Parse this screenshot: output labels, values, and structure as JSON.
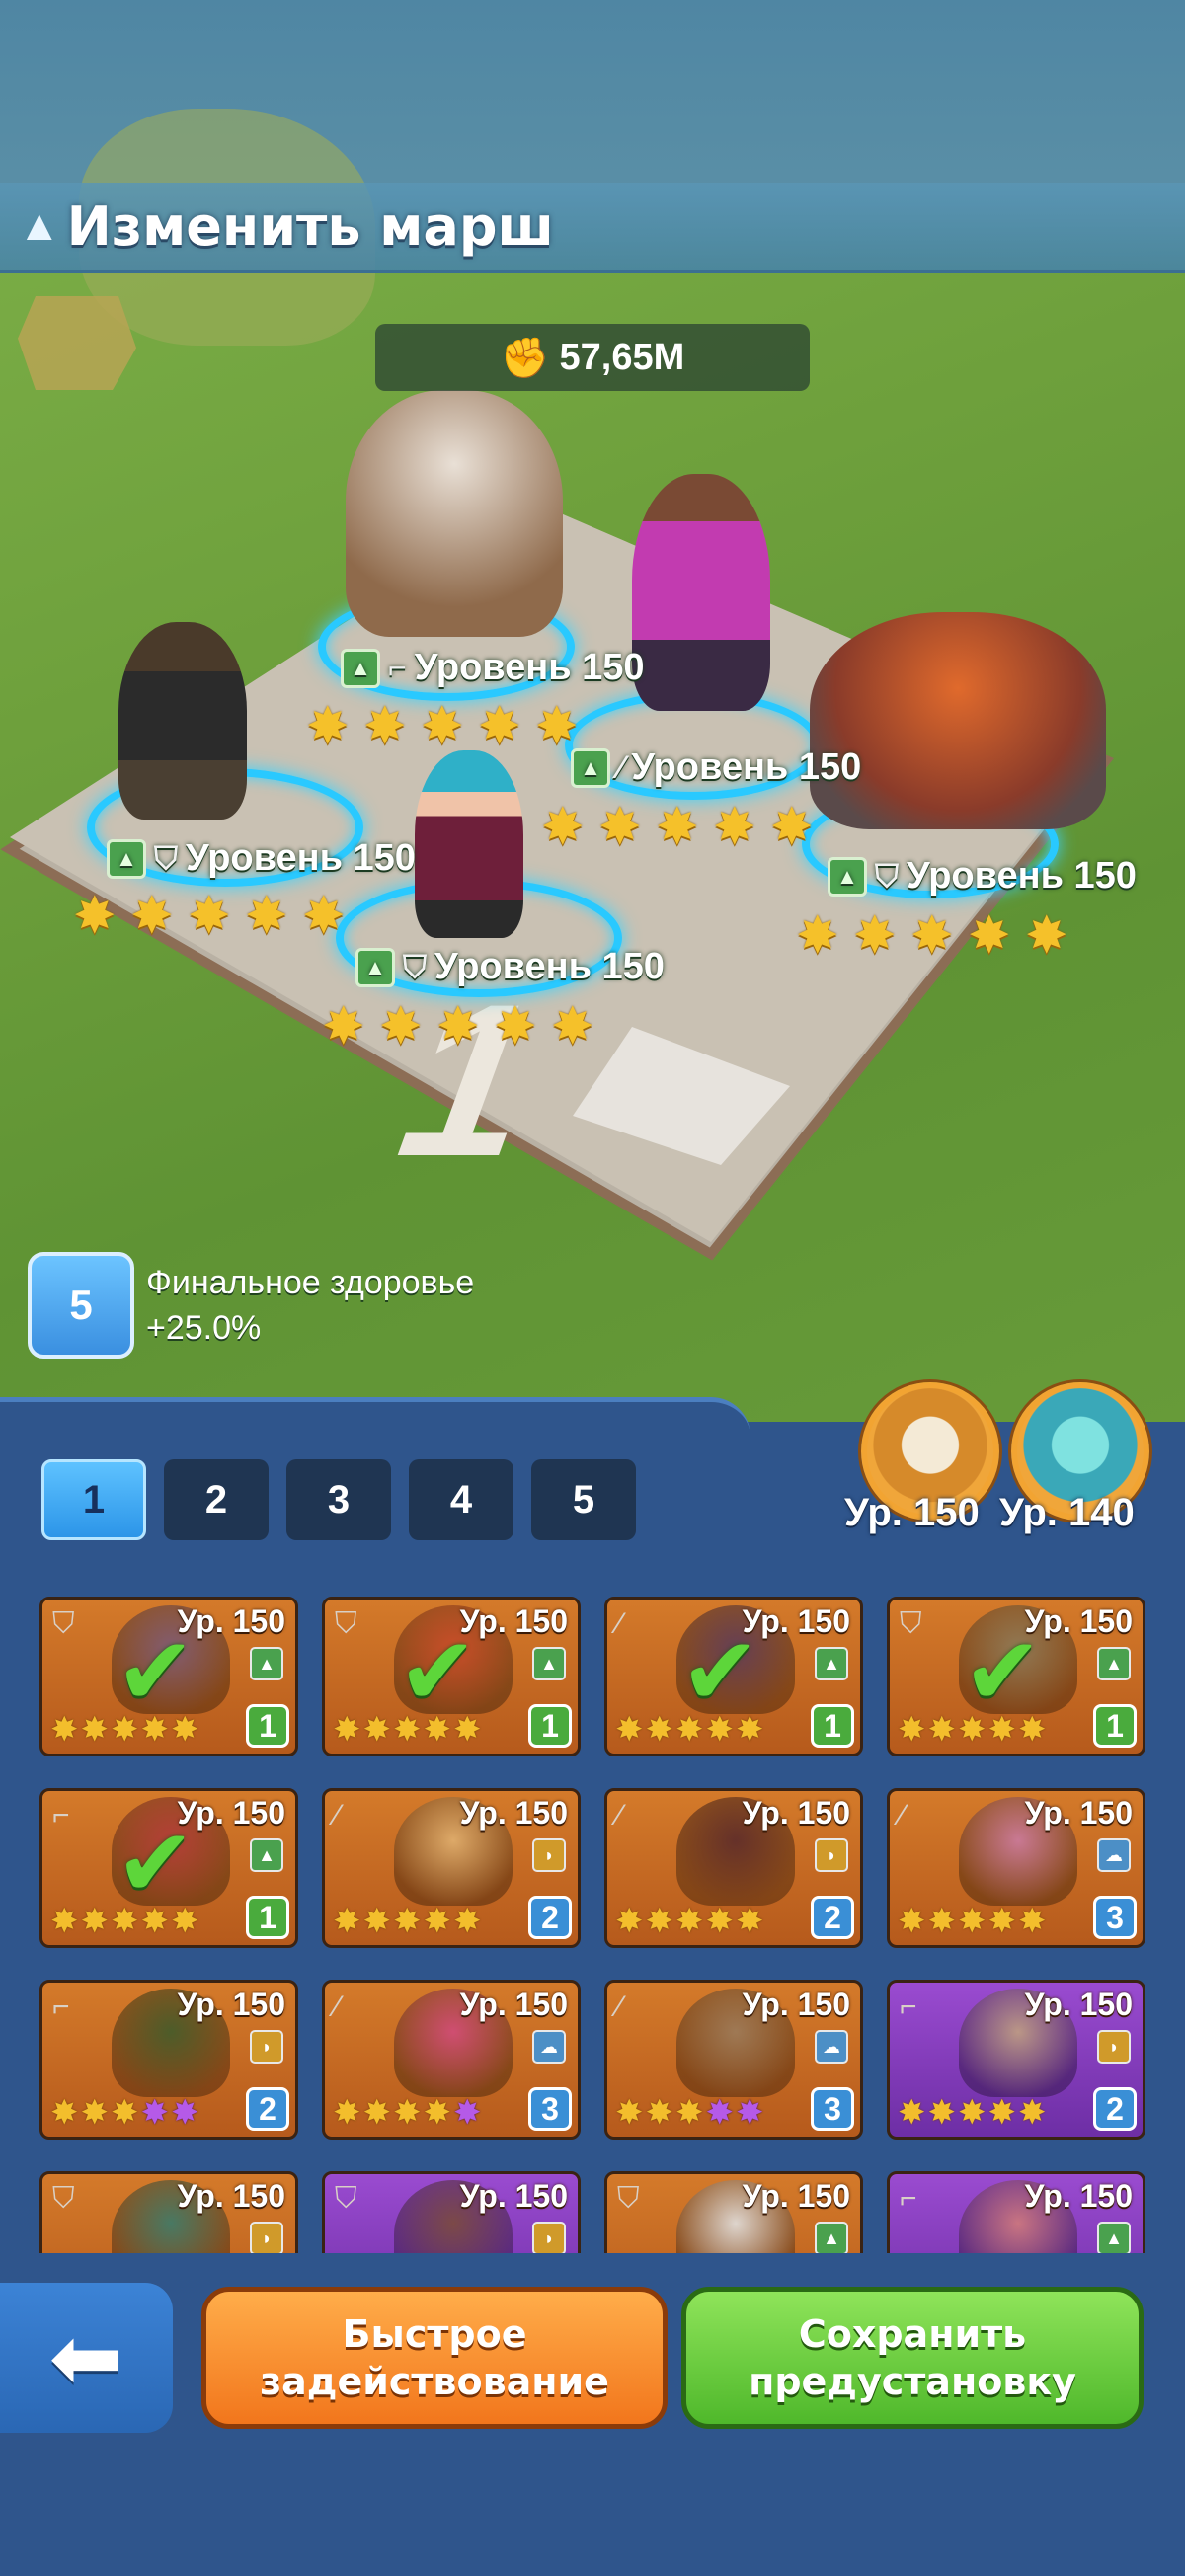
{
  "header": {
    "title": "Изменить марш",
    "title_icon": "arrow-up-icon"
  },
  "power": {
    "icon": "fist-icon",
    "value": "57,65M"
  },
  "formation": {
    "board_number": "1",
    "units": [
      {
        "label": "Уровень 150",
        "role_icon": "pistol-icon",
        "terrain_icon": "mountain-icon",
        "stars": 5
      },
      {
        "label": "Уровень 150",
        "role_icon": "rifle-icon",
        "terrain_icon": "mountain-icon",
        "stars": 5
      },
      {
        "label": "Уровень 150",
        "role_icon": "shield-icon",
        "terrain_icon": "mountain-icon",
        "stars": 5
      },
      {
        "label": "Уровень 150",
        "role_icon": "shield-icon",
        "terrain_icon": "mountain-icon",
        "stars": 5
      },
      {
        "label": "Уровень 150",
        "role_icon": "shield-icon",
        "terrain_icon": "mountain-icon",
        "stars": 5
      }
    ]
  },
  "buff": {
    "icon_number": "5",
    "name": "Финальное здоровье",
    "value": "+25.0%"
  },
  "tabs": [
    "1",
    "2",
    "3",
    "4",
    "5"
  ],
  "active_tab": "1",
  "pets": [
    {
      "icon": "eagle-pet-icon",
      "label": "Ур. 150"
    },
    {
      "icon": "dragon-pet-icon",
      "label": "Ур. 140"
    }
  ],
  "heroes": [
    {
      "level": "Ур. 150",
      "role": "shield-icon",
      "terrain": "mountain",
      "stars": "ggggg",
      "num": "1",
      "numColor": "green",
      "checked": true,
      "rarity": "orange"
    },
    {
      "level": "Ур. 150",
      "role": "shield-icon",
      "terrain": "mountain",
      "stars": "ggggg",
      "num": "1",
      "numColor": "green",
      "checked": true,
      "rarity": "orange"
    },
    {
      "level": "Ур. 150",
      "role": "rifle-icon",
      "terrain": "mountain",
      "stars": "ggggg",
      "num": "1",
      "numColor": "green",
      "checked": true,
      "rarity": "orange"
    },
    {
      "level": "Ур. 150",
      "role": "shield-icon",
      "terrain": "mountain",
      "stars": "ggggg",
      "num": "1",
      "numColor": "green",
      "checked": true,
      "rarity": "orange"
    },
    {
      "level": "Ур. 150",
      "role": "pistol-icon",
      "terrain": "mountain",
      "stars": "ggggg",
      "num": "1",
      "numColor": "green",
      "checked": true,
      "rarity": "orange"
    },
    {
      "level": "Ур. 150",
      "role": "rifle-icon",
      "terrain": "desert",
      "stars": "ggggg",
      "num": "2",
      "numColor": "blue",
      "checked": false,
      "rarity": "orange"
    },
    {
      "level": "Ур. 150",
      "role": "rifle-icon",
      "terrain": "desert",
      "stars": "ggggg",
      "num": "2",
      "numColor": "blue",
      "checked": false,
      "rarity": "orange"
    },
    {
      "level": "Ур. 150",
      "role": "rifle-icon",
      "terrain": "cloud",
      "stars": "ggggg",
      "num": "3",
      "numColor": "blue",
      "checked": false,
      "rarity": "orange"
    },
    {
      "level": "Ур. 150",
      "role": "pistol-icon",
      "terrain": "desert",
      "stars": "gggpp",
      "num": "2",
      "numColor": "blue",
      "checked": false,
      "rarity": "orange"
    },
    {
      "level": "Ур. 150",
      "role": "rifle-icon",
      "terrain": "cloud",
      "stars": "ggggp",
      "num": "3",
      "numColor": "blue",
      "checked": false,
      "rarity": "orange"
    },
    {
      "level": "Ур. 150",
      "role": "rifle-icon",
      "terrain": "cloud",
      "stars": "gggpp",
      "num": "3",
      "numColor": "blue",
      "checked": false,
      "rarity": "orange"
    },
    {
      "level": "Ур. 150",
      "role": "pistol-icon",
      "terrain": "desert",
      "stars": "ggggg",
      "num": "2",
      "numColor": "blue",
      "checked": false,
      "rarity": "purple"
    },
    {
      "level": "Ур. 150",
      "role": "shield-icon",
      "terrain": "desert",
      "stars": "ggggg",
      "num": "",
      "numColor": "blue",
      "checked": false,
      "rarity": "orange"
    },
    {
      "level": "Ур. 150",
      "role": "shield-icon",
      "terrain": "desert",
      "stars": "ggggg",
      "num": "",
      "numColor": "blue",
      "checked": false,
      "rarity": "purple"
    },
    {
      "level": "Ур. 150",
      "role": "shield-icon",
      "terrain": "mountain",
      "stars": "ggggg",
      "num": "",
      "numColor": "blue",
      "checked": false,
      "rarity": "orange"
    },
    {
      "level": "Ур. 150",
      "role": "pistol-icon",
      "terrain": "mountain",
      "stars": "ggggg",
      "num": "",
      "numColor": "blue",
      "checked": false,
      "rarity": "purple"
    }
  ],
  "buttons": {
    "back_icon": "arrow-left-icon",
    "quick_deploy": "Быстрое задействование",
    "save_preset": "Сохранить предустановку"
  },
  "colors": {
    "panel": "#2f558c",
    "ring": "#29c9ff",
    "orange_button": "#f2761c",
    "green_button": "#4fb82b"
  }
}
